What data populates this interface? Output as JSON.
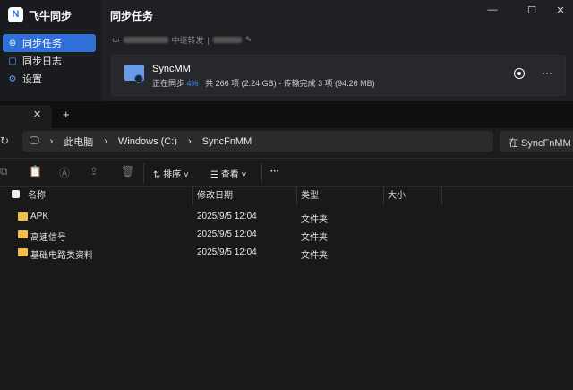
{
  "app": {
    "name": "飞牛同步",
    "logo": "N",
    "title": "同步任务",
    "nav": [
      {
        "label": "同步任务",
        "icon": "sync-icon"
      },
      {
        "label": "同步日志",
        "icon": "log-icon"
      },
      {
        "label": "设置",
        "icon": "gear-icon"
      }
    ],
    "device": {
      "mode": "中继转发"
    },
    "task": {
      "name": "SyncMM",
      "status": "正在同步",
      "percent": "4%",
      "detail": "共 266 项 (2.24 GB) - 传输完成 3 项 (94.26 MB)"
    }
  },
  "explorer": {
    "breadcrumb": [
      "此电脑",
      "Windows (C:)",
      "SyncFnMM"
    ],
    "search_placeholder": "在 SyncFnMM 中搜索",
    "toolbar": {
      "sort": "排序",
      "view": "查看"
    },
    "columns": [
      "名称",
      "修改日期",
      "类型",
      "大小"
    ],
    "rows": [
      {
        "name": "APK",
        "date": "2025/9/5 12:04",
        "type": "文件夹"
      },
      {
        "name": "高速信号",
        "date": "2025/9/5 12:04",
        "type": "文件夹"
      },
      {
        "name": "基础电路类资料",
        "date": "2025/9/5 12:04",
        "type": "文件夹"
      }
    ]
  }
}
